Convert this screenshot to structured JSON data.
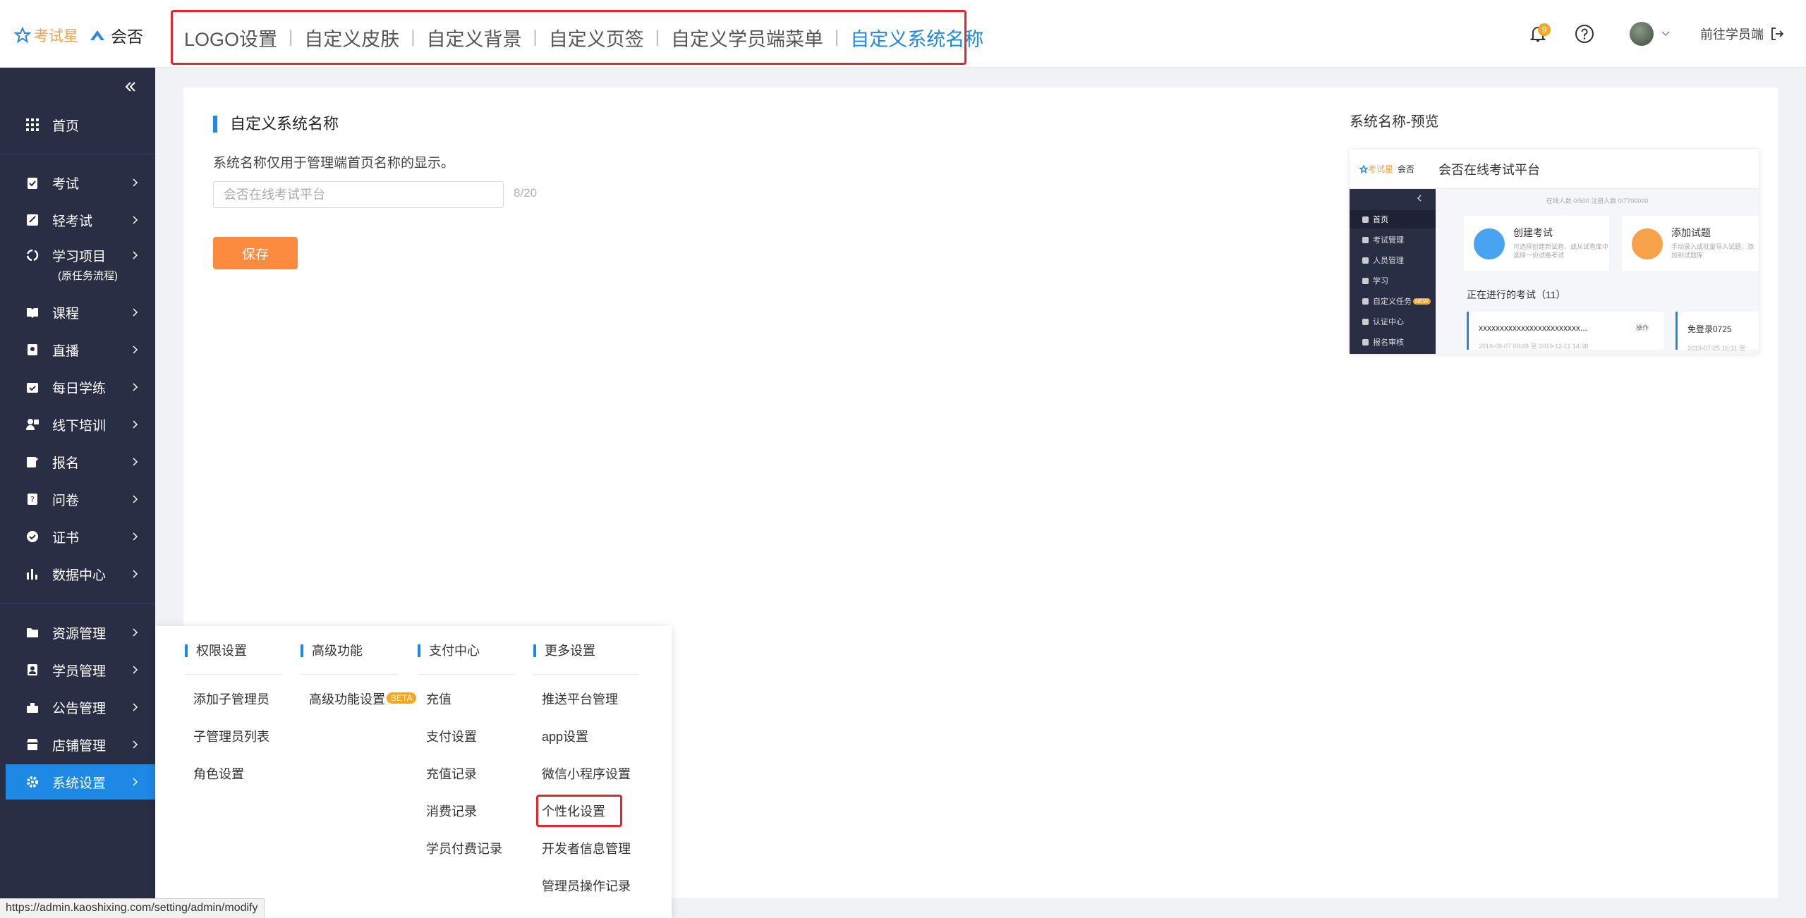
{
  "brand": {
    "logo_left": "考试星",
    "logo_right": "会否"
  },
  "header": {
    "tabs": [
      "LOGO设置",
      "自定义皮肤",
      "自定义背景",
      "自定义页签",
      "自定义学员端菜单",
      "自定义系统名称"
    ],
    "active_tab": "自定义系统名称",
    "notification_count": "9",
    "student_link": "前往学员端"
  },
  "sidebar": {
    "items": [
      {
        "label": "首页",
        "icon": "grid-icon"
      },
      {
        "label": "考试",
        "icon": "clipboard-icon"
      },
      {
        "label": "轻考试",
        "icon": "light-exam-icon"
      },
      {
        "label": "学习项目",
        "sub": "(原任务流程)",
        "icon": "recycle-icon"
      },
      {
        "label": "课程",
        "icon": "book-icon"
      },
      {
        "label": "直播",
        "icon": "live-icon"
      },
      {
        "label": "每日学练",
        "icon": "calendar-check-icon"
      },
      {
        "label": "线下培训",
        "icon": "training-icon"
      },
      {
        "label": "报名",
        "icon": "signup-icon"
      },
      {
        "label": "问卷",
        "icon": "survey-icon"
      },
      {
        "label": "证书",
        "icon": "certificate-icon"
      },
      {
        "label": "数据中心",
        "icon": "bar-chart-icon"
      },
      {
        "label": "资源管理",
        "icon": "folder-icon"
      },
      {
        "label": "学员管理",
        "icon": "student-icon"
      },
      {
        "label": "公告管理",
        "icon": "announcement-icon"
      },
      {
        "label": "店铺管理",
        "icon": "store-icon"
      },
      {
        "label": "系统设置",
        "icon": "gear-icon"
      }
    ],
    "active_item": "系统设置"
  },
  "main": {
    "section_title": "自定义系统名称",
    "description": "系统名称仅用于管理端首页名称的显示。",
    "input_placeholder": "会否在线考试平台",
    "counter": "8/20",
    "save_label": "保存"
  },
  "preview": {
    "title": "系统名称-预览",
    "logo_left": "考试星",
    "logo_right": "会否",
    "system_name": "会否在线考试平台",
    "menu": [
      "首页",
      "考试管理",
      "人员管理",
      "学习",
      "自定义任务",
      "认证中心",
      "报名审核"
    ],
    "menu_badge": "NEW",
    "stats": "在线人数 0/500          注册人数 0/7700000",
    "card1_title": "创建考试",
    "card1_desc": "可选择创建新试卷、或从试卷库中选择一份试卷考试",
    "card2_title": "添加试题",
    "card2_desc": "手动录入或批量导入试题，添加到试题库",
    "ongoing": "正在进行的考试（11）",
    "exam1_title": "xxxxxxxxxxxxxxxxxxxxxxxx...",
    "exam1_action": "操作",
    "exam1_date": "2019-08-07 09:48 至 2019-12-11 14:38",
    "exam2_title": "免登录0725",
    "exam2_date": "2019-07-25 16:31 至"
  },
  "dropdown": {
    "columns": [
      {
        "header": "权限设置",
        "items": [
          "添加子管理员",
          "子管理员列表",
          "角色设置"
        ]
      },
      {
        "header": "高级功能",
        "items": [
          "高级功能设置"
        ],
        "badge": "BETA"
      },
      {
        "header": "支付中心",
        "items": [
          "充值",
          "支付设置",
          "充值记录",
          "消费记录",
          "学员付费记录"
        ]
      },
      {
        "header": "更多设置",
        "items": [
          "推送平台管理",
          "app设置",
          "微信小程序设置",
          "个性化设置",
          "开发者信息管理",
          "管理员操作记录"
        ]
      }
    ]
  },
  "status_url": "https://admin.kaoshixing.com/setting/admin/modify",
  "colors": {
    "accent": "#1e88e5",
    "save": "#fd8b3f",
    "sidebar": "#2a2e45",
    "highlight": "#e5262a",
    "badge": "#f5a623"
  }
}
